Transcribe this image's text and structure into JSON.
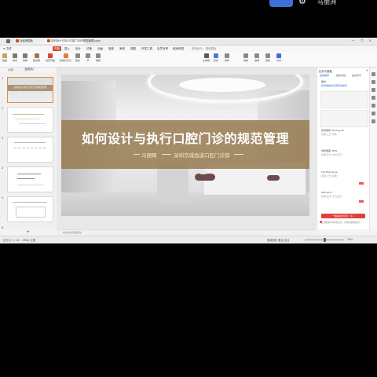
{
  "overlay": {
    "top_right_text": "马丽洲"
  },
  "titlebar": {
    "tabs": [
      {
        "label": "WPS Office"
      },
      {
        "label": "找稻壳模板"
      },
      {
        "label": "如何设计与执行口腔门诊的规范管理.pptx"
      }
    ],
    "window_controls": "— ❐ ✕"
  },
  "menubar": {
    "file": "≡ 文件",
    "items": [
      "开始",
      "插入",
      "设计",
      "切换",
      "动画",
      "放映",
      "审阅",
      "视图",
      "开发工具",
      "会员专享",
      "稻壳资源",
      "查找命令、搜索模板"
    ]
  },
  "ribbon": {
    "items": [
      "粘贴",
      "剪切",
      "复制",
      "格式刷",
      "当页开始",
      "新建幻灯片",
      "版式",
      "节",
      "重置",
      "文本框",
      "形状",
      "排列",
      "替换",
      "选择",
      "查找",
      "分享"
    ]
  },
  "left_pane": {
    "tab_outline": "大纲",
    "tab_slides": "幻灯片",
    "thumb1_title": "如何设计与执行口腔门诊的规范管理",
    "add_slide": "+"
  },
  "slide": {
    "title": "如何设计与执行口腔门诊的规范管理",
    "presenter": "马丽辉",
    "organization": "深圳京城齿道口腔门诊部"
  },
  "right_pane": {
    "header": "幻灯片模板",
    "close": "✕",
    "tabs": [
      "最新推荐",
      "我的文档",
      "会员专享"
    ],
    "section1": "版式",
    "section1_sub": "将智能版式应用到当前页",
    "font1": "思源黑体 CN Regular",
    "font1_sub": "标题  正文  字体",
    "font2": "微软雅黑_MD5-",
    "font2_sub": "标题/正文 方方正正",
    "font3": "FandHandone",
    "font3_sub": "标题  正文  字体",
    "font4": "PMingLiU",
    "font4_sub": "标题/正文 方方正正",
    "button": "一键美化幻灯片（1）",
    "note": "此功能由WPS提供支持，请勿泄露敏感信息"
  },
  "notes": {
    "placeholder": "单击此处添加备注"
  },
  "statusbar": {
    "page": "幻灯片 1 / 18",
    "theme": "Office 主题",
    "right": "智能美化  备注  批注",
    "zoom": "76%"
  },
  "colors": {
    "accent": "#d24a2f",
    "title_band": "#987c52",
    "overlay_blue": "#3d6fd8"
  }
}
